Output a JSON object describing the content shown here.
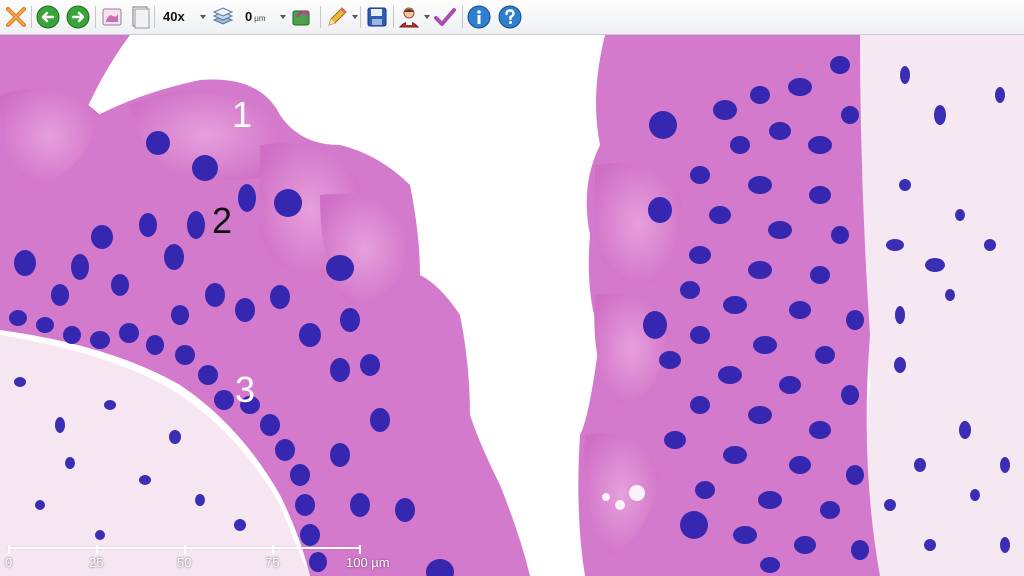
{
  "toolbar": {
    "zoom_value": "40x",
    "thickness_value": "0",
    "thickness_unit": "µm",
    "buttons": [
      {
        "name": "close-slide-icon"
      },
      {
        "name": "back-arrow-icon"
      },
      {
        "name": "forward-arrow-icon"
      },
      {
        "name": "slide-thumbnail-icon"
      },
      {
        "name": "blank-page-icon"
      },
      {
        "name": "zoom-dropdown-icon"
      },
      {
        "name": "layers-icon"
      },
      {
        "name": "rotate-icon"
      },
      {
        "name": "pencil-icon"
      },
      {
        "name": "save-icon"
      },
      {
        "name": "user-icon"
      },
      {
        "name": "check-icon"
      },
      {
        "name": "info-icon"
      },
      {
        "name": "help-icon"
      }
    ]
  },
  "annotations": {
    "label_1": "1",
    "label_2": "2",
    "label_3": "3"
  },
  "scalebar": {
    "ticks": [
      "0",
      "25",
      "50",
      "75",
      "100 µm"
    ]
  },
  "colors": {
    "cytoplasm": "#d97fd0",
    "nucleus": "#3a2fb4",
    "stroma": "#f6e8f3",
    "background": "#ffffff"
  }
}
